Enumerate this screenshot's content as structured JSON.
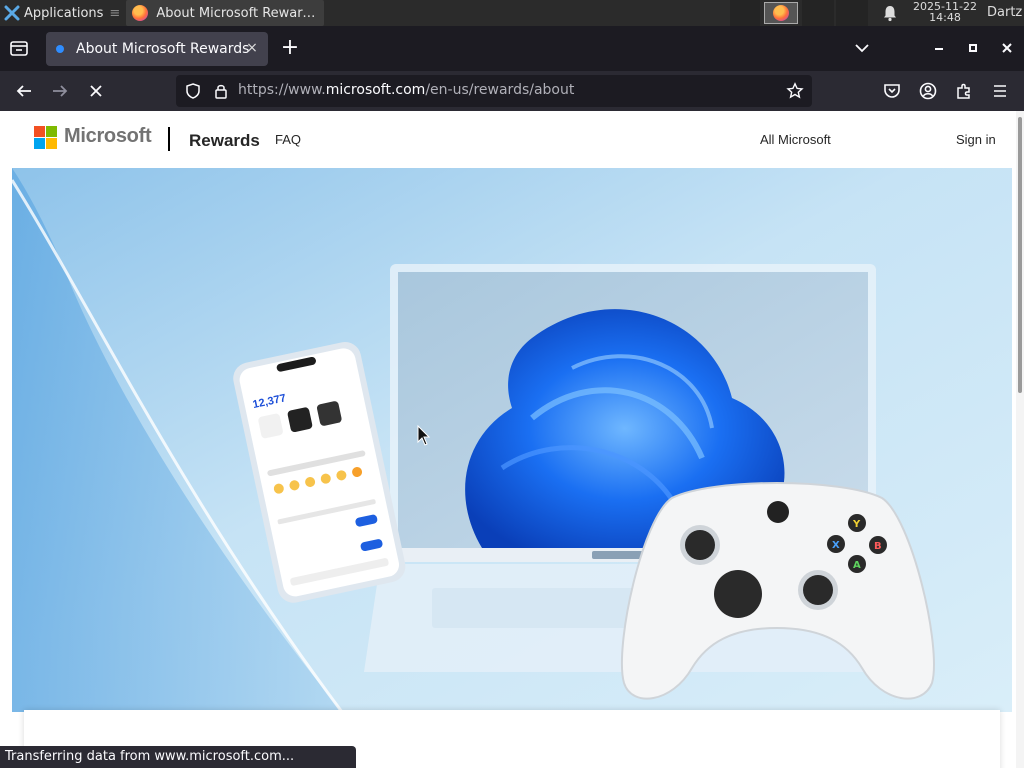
{
  "taskbar": {
    "apps_label": "Applications",
    "apps_sep": "≡",
    "window_title": "About Microsoft Reward...",
    "clock_date": "2025-11-22",
    "clock_time": "14:48",
    "user": "Dartz"
  },
  "browser": {
    "tab_title": "About Microsoft Rewards",
    "tab_close": "×",
    "new_tab": "+",
    "url_prefix": "https://www.",
    "url_host": "microsoft.com",
    "url_path": "/en-us/rewards/about",
    "status_text": "Transferring data from www.microsoft.com..."
  },
  "page": {
    "brand": "Microsoft",
    "nav": {
      "rewards": "Rewards",
      "faq": "FAQ",
      "all_microsoft": "All Microsoft",
      "sign_in": "Sign in"
    },
    "hero_phone": {
      "points": "12,377"
    }
  },
  "colors": {
    "ms_red": "#f25022",
    "ms_green": "#7fba00",
    "ms_blue": "#00a4ef",
    "ms_yellow": "#ffb900",
    "hero_bg": "#bfe0f3",
    "bloom_blue": "#0d5ef0"
  }
}
